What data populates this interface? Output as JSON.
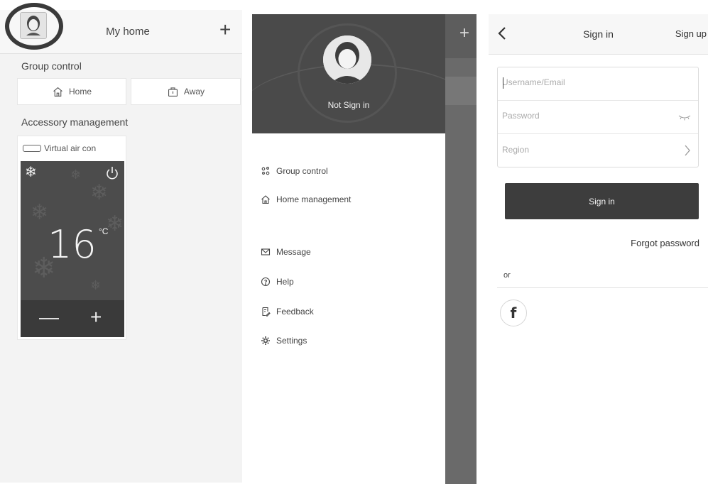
{
  "home": {
    "title": "My home",
    "group_control_label": "Group control",
    "group_buttons": [
      {
        "label": "Home",
        "icon": "house-icon"
      },
      {
        "label": "Away",
        "icon": "suitcase-icon"
      }
    ],
    "accessory_label": "Accessory management",
    "accessory": {
      "name": "Virtual air con",
      "temperature": "16",
      "unit": "°C",
      "minus": "—",
      "plus": "+",
      "mode_icon": "snowflake-icon",
      "power_icon": "power-icon"
    },
    "add_symbol": "+"
  },
  "drawer": {
    "user_status": "Not Sign in",
    "add_symbol": "+",
    "menu": [
      {
        "label": "Group control",
        "icon": "group-control-icon"
      },
      {
        "label": "Home management",
        "icon": "house-icon"
      },
      {
        "label": "Message",
        "icon": "envelope-icon"
      },
      {
        "label": "Help",
        "icon": "help-icon"
      },
      {
        "label": "Feedback",
        "icon": "feedback-icon"
      },
      {
        "label": "Settings",
        "icon": "gear-icon"
      }
    ]
  },
  "signin": {
    "title": "Sign in",
    "signup_label": "Sign up",
    "username_placeholder": "Username/Email",
    "password_placeholder": "Password",
    "region_label": "Region",
    "signin_button": "Sign in",
    "forgot_label": "Forgot password",
    "or_label": "or",
    "facebook_glyph": "f"
  },
  "colors": {
    "dark_button": "#3d3d3d",
    "drawer_header": "#4a4a4a",
    "panel_bg": "#f3f3f3"
  }
}
